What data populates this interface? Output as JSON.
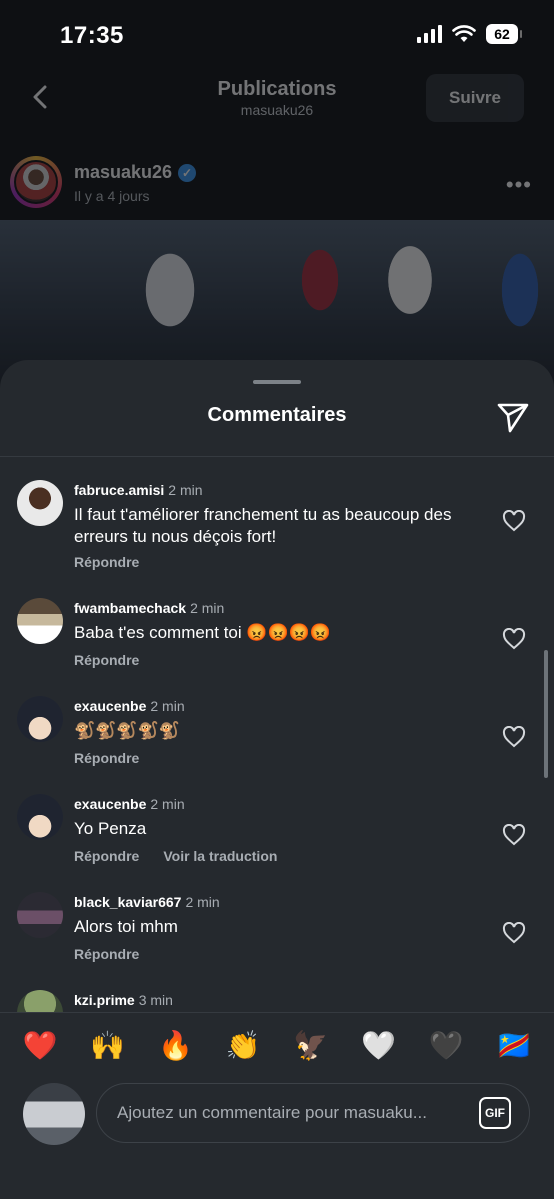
{
  "status_bar": {
    "time": "17:35",
    "battery": "62"
  },
  "nav": {
    "title": "Publications",
    "subtitle": "masuaku26",
    "follow_label": "Suivre"
  },
  "post": {
    "username": "masuaku26",
    "time_ago": "Il y a 4 jours",
    "verified_icon": "verified-badge-icon"
  },
  "sheet": {
    "title": "Commentaires",
    "share_icon": "send-icon"
  },
  "comments": [
    {
      "username": "fabruce.amisi",
      "time": "2 min",
      "text": "Il faut t'améliorer franchement tu as beaucoup des erreurs tu nous déçois fort!",
      "reply": "Répondre"
    },
    {
      "username": "fwambamechack",
      "time": "2 min",
      "text": "Baba t'es comment toi 😡😡😡😡",
      "reply": "Répondre"
    },
    {
      "username": "exaucenbe",
      "time": "2 min",
      "text": "🐒🐒🐒🐒🐒",
      "reply": "Répondre"
    },
    {
      "username": "exaucenbe",
      "time": "2 min",
      "text": "Yo Penza",
      "reply": "Répondre",
      "translate": "Voir la traduction"
    },
    {
      "username": "black_kaviar667",
      "time": "2 min",
      "text": "Alors toi mhm",
      "reply": "Répondre"
    },
    {
      "username": "kzi.prime",
      "time": "3 min"
    }
  ],
  "emoji_reactions": [
    "❤️",
    "🙌",
    "🔥",
    "👏",
    "🦅",
    "🤍",
    "🖤",
    "🇨🇩"
  ],
  "composer": {
    "placeholder": "Ajoutez un commentaire pour masuaku...",
    "gif_label": "GIF"
  },
  "colors": {
    "sheet_bg": "#25292e",
    "page_bg": "#0e1013",
    "verified": "#3897f0",
    "muted_text": "#a8adb3"
  }
}
